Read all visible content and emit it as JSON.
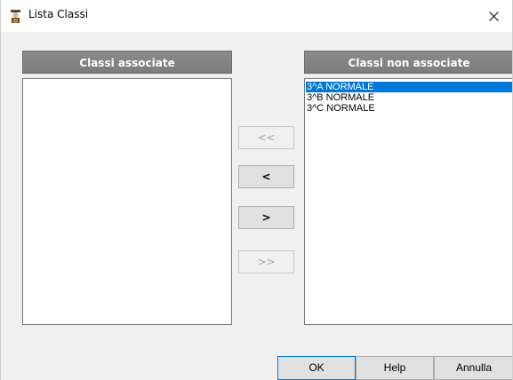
{
  "window": {
    "title": "Lista Classi",
    "close_glyph": "✕"
  },
  "left_panel": {
    "header": "Classi associate",
    "items": []
  },
  "right_panel": {
    "header": "Classi non associate",
    "items": [
      {
        "label": "3^A NORMALE",
        "selected": true
      },
      {
        "label": "3^B NORMALE",
        "selected": false
      },
      {
        "label": "3^C NORMALE",
        "selected": false
      }
    ]
  },
  "move_buttons": {
    "move_all_left": {
      "label": "<<",
      "enabled": false
    },
    "move_left": {
      "label": "<",
      "enabled": true
    },
    "move_right": {
      "label": ">",
      "enabled": true
    },
    "move_all_right": {
      "label": ">>",
      "enabled": false
    }
  },
  "footer": {
    "ok_label": "OK",
    "help_label": "Help",
    "cancel_label": "Annulla"
  },
  "colors": {
    "header_bg": "#808080",
    "selection": "#0078d7",
    "window_bg": "#f0f0f0"
  }
}
